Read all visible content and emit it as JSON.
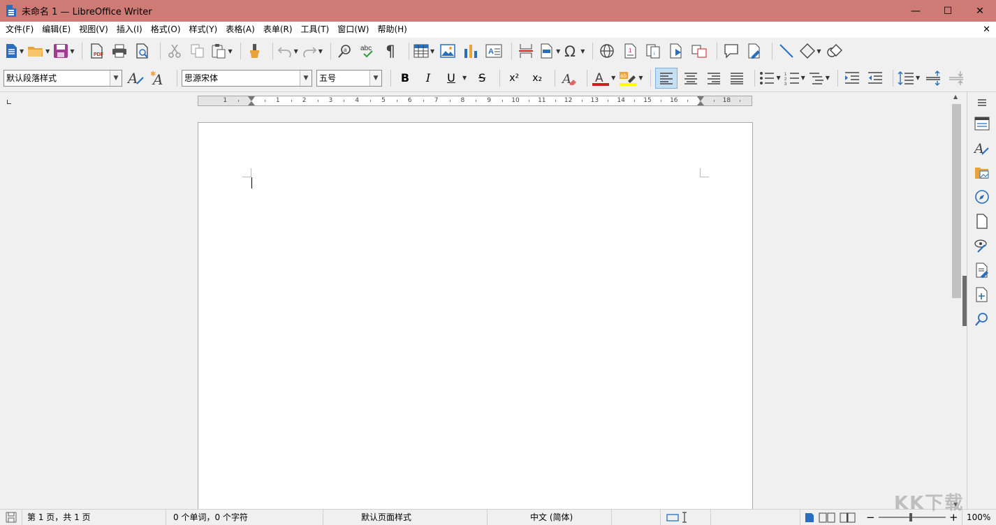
{
  "window": {
    "title": "未命名 1 — LibreOffice Writer",
    "minimize": "—",
    "maximize": "☐",
    "close": "✕",
    "doc_close": "✕"
  },
  "menu": [
    "文件(F)",
    "编辑(E)",
    "视图(V)",
    "插入(I)",
    "格式(O)",
    "样式(Y)",
    "表格(A)",
    "表单(R)",
    "工具(T)",
    "窗口(W)",
    "帮助(H)"
  ],
  "formatting": {
    "paragraph_style": "默认段落样式",
    "font_name": "思源宋体",
    "font_size": "五号",
    "bold": "B",
    "italic": "I",
    "underline": "U",
    "strikethrough": "S",
    "superscript": "x²",
    "subscript": "x₂"
  },
  "ruler": {
    "numbers": [
      "1",
      "1",
      "2",
      "3",
      "4",
      "5",
      "6",
      "7",
      "8",
      "9",
      "10",
      "11",
      "12",
      "13",
      "14",
      "15",
      "16",
      "18"
    ]
  },
  "status": {
    "page": "第 1 页，共 1 页",
    "words": "0 个单词，0 个字符",
    "page_style": "默认页面样式",
    "language": "中文 (简体)",
    "zoom": "100%",
    "zoom_minus": "−",
    "zoom_plus": "+"
  },
  "watermark": "KK下载",
  "colors": {
    "titlebar": "#cd7b74",
    "accent": "#2a6ebd",
    "font_color": "#c9211e",
    "highlight": "#ffff00"
  }
}
